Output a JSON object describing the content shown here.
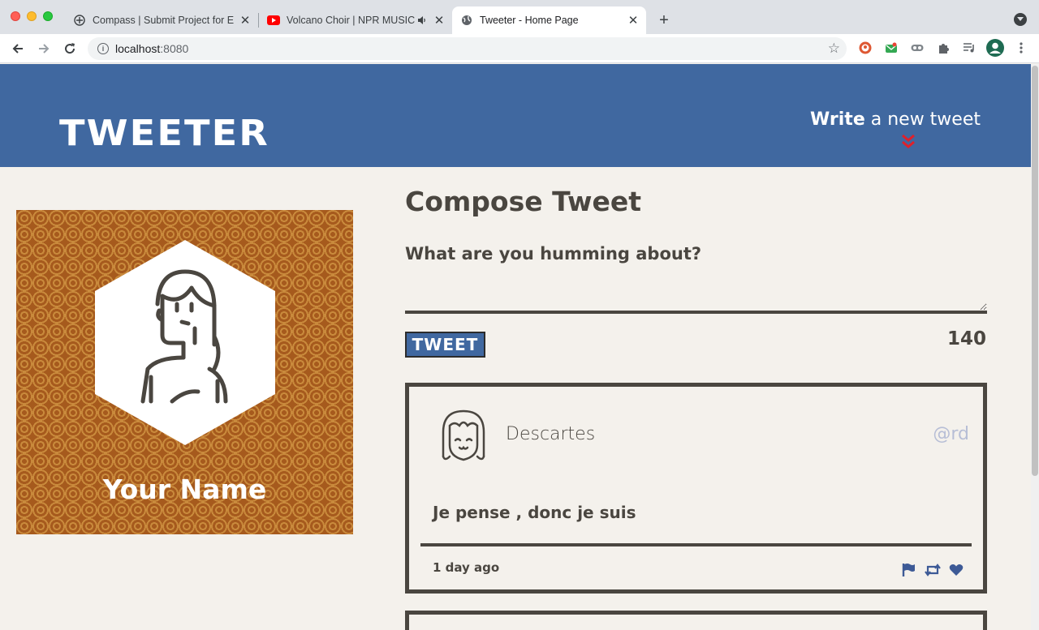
{
  "browser": {
    "tabs": [
      {
        "title": "Compass | Submit Project for E",
        "favicon": "compass-favicon",
        "active": false
      },
      {
        "title": "Volcano Choir | NPR MUSIC",
        "favicon": "youtube-favicon",
        "audio": true,
        "active": false
      },
      {
        "title": "Tweeter - Home Page",
        "favicon": "globe-favicon",
        "active": true
      }
    ],
    "new_tab_label": "+",
    "url_host": "localhost",
    "url_port": ":8080"
  },
  "header": {
    "logo": "TWEETER",
    "write_bold": "Write",
    "write_rest": " a new tweet"
  },
  "profile": {
    "name": "Your Name",
    "background_color": "#a65a1d"
  },
  "compose": {
    "title": "Compose Tweet",
    "label": "What are you humming about?",
    "textarea_value": "",
    "button_label": "TWEET",
    "char_counter": "140"
  },
  "tweets": [
    {
      "author": "Descartes",
      "handle": "@rd",
      "content": "Je pense , donc je suis",
      "time": "1 day ago",
      "actions": [
        "flag-icon",
        "retweet-icon",
        "heart-icon"
      ]
    }
  ],
  "colors": {
    "header_blue": "#4068a0",
    "page_bg": "#f4f1ec",
    "text_dark": "#4a4640",
    "handle_light": "#b7bed6",
    "accent_red": "#e0202a"
  }
}
